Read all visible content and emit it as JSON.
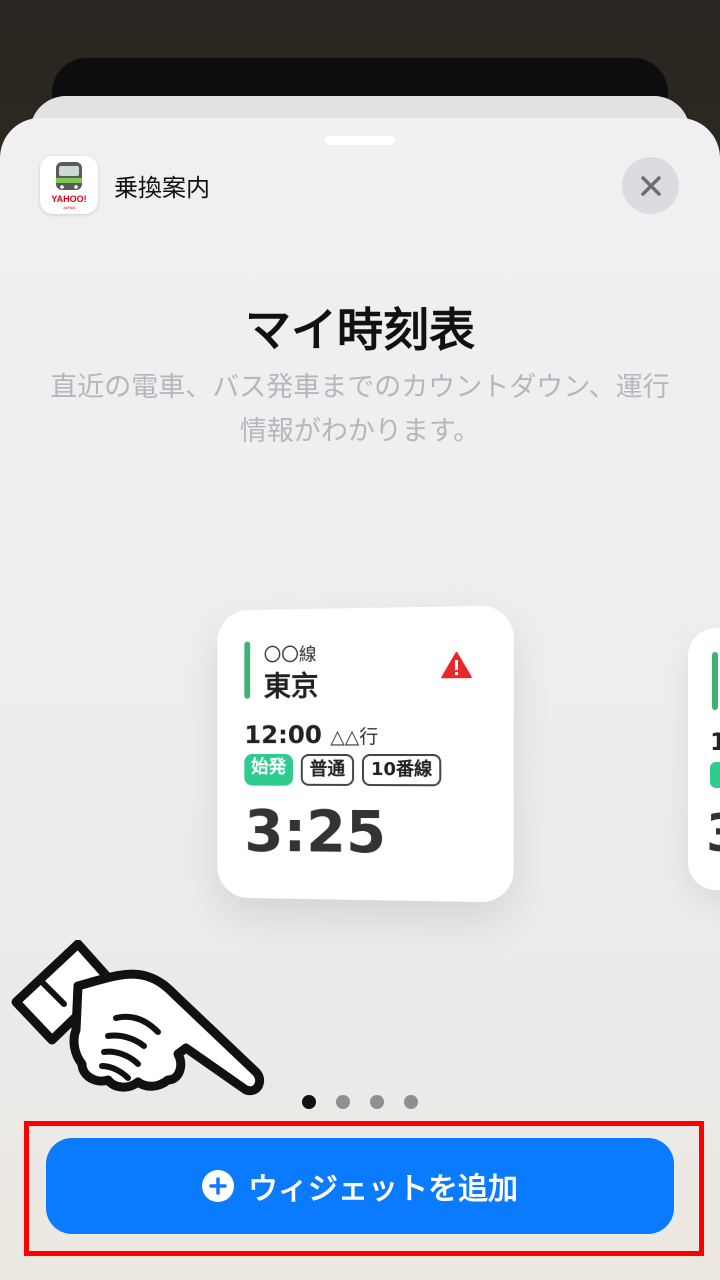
{
  "app": {
    "name": "乗換案内",
    "icon": "yahoo-transit-train-icon"
  },
  "sheet": {
    "title": "マイ時刻表",
    "description": "直近の電車、バス発車までのカウントダウン、運行情報がわかります。"
  },
  "widget": {
    "line": "〇〇線",
    "station": "東京",
    "time": "12:00",
    "destination": "△△行",
    "tags": [
      "始発",
      "普通",
      "10番線"
    ],
    "countdown": "3:25",
    "accent_color": "#3cb371",
    "warning_icon": "warning-triangle-icon"
  },
  "widget_peek": {
    "digit": "1",
    "countdown": "3"
  },
  "pagination": {
    "total": 4,
    "active": 0
  },
  "add_button": {
    "label": "ウィジェットを追加",
    "icon": "plus-circle-icon"
  },
  "colors": {
    "button": "#0a7aff",
    "highlight": "#ff0000",
    "tag_green": "#2ecc8f"
  }
}
